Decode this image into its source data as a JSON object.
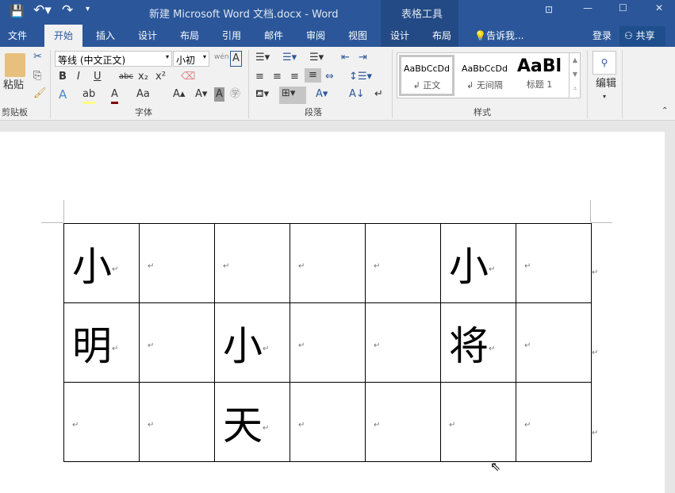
{
  "title": {
    "doc": "新建 Microsoft Word 文档.docx - Word",
    "context": "表格工具"
  },
  "tabs": [
    "文件",
    "开始",
    "插入",
    "设计",
    "布局",
    "引用",
    "邮件",
    "审阅",
    "视图",
    "设计",
    "布局"
  ],
  "tell_me": "告诉我...",
  "login": "登录",
  "share": "共享",
  "clipboard": {
    "paste": "粘贴",
    "group": "剪贴板"
  },
  "font": {
    "name": "等线 (中文正文)",
    "size": "小初",
    "group": "字体",
    "bold": "B",
    "italic": "I",
    "underline": "U",
    "strike": "abc",
    "sub": "x₂",
    "sup": "x²",
    "case": "Aa"
  },
  "paragraph": {
    "group": "段落"
  },
  "styles": {
    "group": "样式",
    "items": [
      {
        "preview": "AaBbCcDd",
        "label": "↲ 正文"
      },
      {
        "preview": "AaBbCcDd",
        "label": "↲ 无间隔"
      },
      {
        "preview": "AaBl",
        "label": "标题 1"
      }
    ]
  },
  "editing": {
    "label": "编辑"
  },
  "table": {
    "rows": [
      [
        "小",
        "",
        "",
        "",
        "",
        "小",
        ""
      ],
      [
        "明",
        "",
        "小",
        "",
        "",
        "将",
        ""
      ],
      [
        "",
        "",
        "天",
        "",
        "",
        "",
        ""
      ]
    ]
  },
  "para_mark": "↵"
}
